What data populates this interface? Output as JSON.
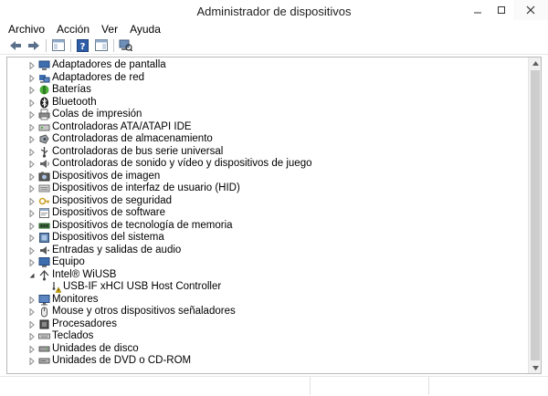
{
  "window": {
    "title": "Administrador de dispositivos"
  },
  "menu": [
    {
      "label": "Archivo",
      "name": "menu-archivo"
    },
    {
      "label": "Acción",
      "name": "menu-accion"
    },
    {
      "label": "Ver",
      "name": "menu-ver"
    },
    {
      "label": "Ayuda",
      "name": "menu-ayuda"
    }
  ],
  "toolbar": [
    {
      "name": "back-button",
      "icon": "back-arrow-icon"
    },
    {
      "name": "forward-button",
      "icon": "forward-arrow-icon"
    },
    {
      "name": "properties-view-button",
      "icon": "console-tree-icon"
    },
    {
      "name": "help-button",
      "icon": "help-icon"
    },
    {
      "name": "action-pane-button",
      "icon": "action-pane-icon"
    },
    {
      "name": "scan-hardware-button",
      "icon": "scan-hardware-icon"
    }
  ],
  "tree": [
    {
      "label": "Adaptadores de pantalla",
      "icon": "display-adapter-icon",
      "level": 0,
      "expanded": false
    },
    {
      "label": "Adaptadores de red",
      "icon": "network-adapter-icon",
      "level": 0,
      "expanded": false
    },
    {
      "label": "Baterías",
      "icon": "battery-icon",
      "level": 0,
      "expanded": false
    },
    {
      "label": "Bluetooth",
      "icon": "bluetooth-icon",
      "level": 0,
      "expanded": false
    },
    {
      "label": "Colas de impresión",
      "icon": "printer-icon",
      "level": 0,
      "expanded": false
    },
    {
      "label": "Controladoras ATA/ATAPI IDE",
      "icon": "ide-controller-icon",
      "level": 0,
      "expanded": false
    },
    {
      "label": "Controladoras de almacenamiento",
      "icon": "storage-controller-icon",
      "level": 0,
      "expanded": false
    },
    {
      "label": "Controladoras de bus serie universal",
      "icon": "usb-controller-icon",
      "level": 0,
      "expanded": false
    },
    {
      "label": "Controladoras de sonido y vídeo y dispositivos de juego",
      "icon": "sound-icon",
      "level": 0,
      "expanded": false
    },
    {
      "label": "Dispositivos de imagen",
      "icon": "imaging-device-icon",
      "level": 0,
      "expanded": false
    },
    {
      "label": "Dispositivos de interfaz de usuario (HID)",
      "icon": "hid-icon",
      "level": 0,
      "expanded": false
    },
    {
      "label": "Dispositivos de seguridad",
      "icon": "security-device-icon",
      "level": 0,
      "expanded": false
    },
    {
      "label": "Dispositivos de software",
      "icon": "software-device-icon",
      "level": 0,
      "expanded": false
    },
    {
      "label": "Dispositivos de tecnología de memoria",
      "icon": "memory-device-icon",
      "level": 0,
      "expanded": false
    },
    {
      "label": "Dispositivos del sistema",
      "icon": "system-device-icon",
      "level": 0,
      "expanded": false
    },
    {
      "label": "Entradas y salidas de audio",
      "icon": "audio-io-icon",
      "level": 0,
      "expanded": false
    },
    {
      "label": "Equipo",
      "icon": "computer-icon",
      "level": 0,
      "expanded": false
    },
    {
      "label": "Intel® WiUSB",
      "icon": "wiusb-icon",
      "level": 0,
      "expanded": true
    },
    {
      "label": "USB-IF xHCI USB Host Controller",
      "icon": "warning-device-icon",
      "level": 1,
      "expanded": null
    },
    {
      "label": "Monitores",
      "icon": "monitor-icon",
      "level": 0,
      "expanded": false
    },
    {
      "label": "Mouse y otros dispositivos señaladores",
      "icon": "mouse-icon",
      "level": 0,
      "expanded": false
    },
    {
      "label": "Procesadores",
      "icon": "processor-icon",
      "level": 0,
      "expanded": false
    },
    {
      "label": "Teclados",
      "icon": "keyboard-icon",
      "level": 0,
      "expanded": false
    },
    {
      "label": "Unidades de disco",
      "icon": "disk-drive-icon",
      "level": 0,
      "expanded": false
    },
    {
      "label": "Unidades de DVD o CD-ROM",
      "icon": "dvd-drive-icon",
      "level": 0,
      "expanded": false
    }
  ]
}
